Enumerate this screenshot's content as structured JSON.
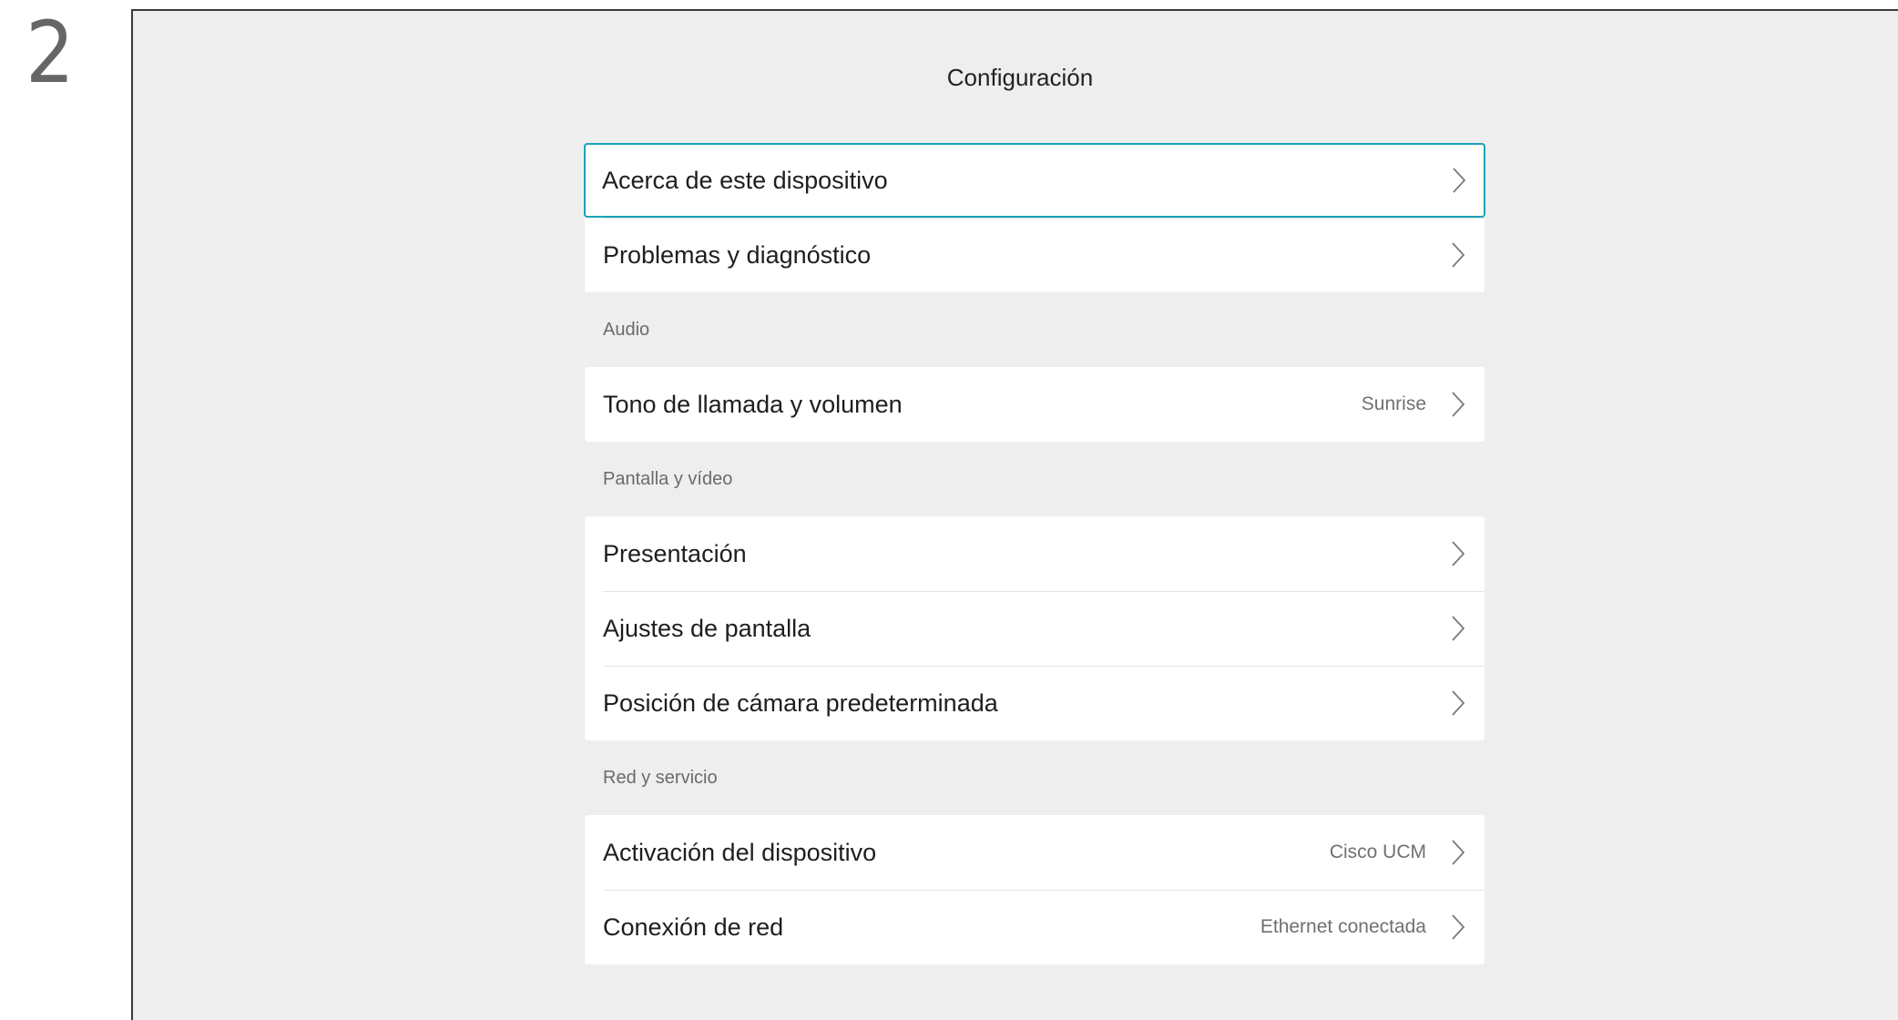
{
  "step_number": "2",
  "title": "Configuración",
  "groups": [
    {
      "header": "",
      "items": [
        {
          "label": "Acerca de este dispositivo",
          "value": "",
          "selected": true
        },
        {
          "label": "Problemas y diagnóstico",
          "value": ""
        }
      ]
    },
    {
      "header": "Audio",
      "items": [
        {
          "label": "Tono de llamada y volumen",
          "value": "Sunrise"
        }
      ]
    },
    {
      "header": "Pantalla y vídeo",
      "items": [
        {
          "label": "Presentación",
          "value": ""
        },
        {
          "label": "Ajustes de pantalla",
          "value": ""
        },
        {
          "label": "Posición de cámara predeterminada",
          "value": ""
        }
      ]
    },
    {
      "header": "Red y servicio",
      "items": [
        {
          "label": "Activación del dispositivo",
          "value": "Cisco UCM"
        },
        {
          "label": "Conexión de red",
          "value": "Ethernet conectada"
        }
      ]
    }
  ],
  "colors": {
    "background": "#eeeeee",
    "card": "#ffffff",
    "focus_border": "#1aa3b8",
    "chevron": "#7a7a7a"
  },
  "icons": {
    "row_arrow": "chevron-right-icon"
  }
}
